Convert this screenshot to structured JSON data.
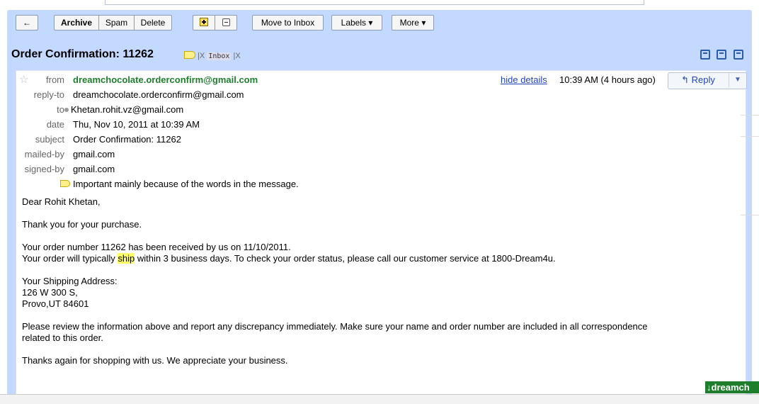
{
  "toolbar": {
    "back_label": "←",
    "archive_label": "Archive",
    "spam_label": "Spam",
    "delete_label": "Delete",
    "move_label": "Move to Inbox",
    "labels_label": "Labels ▾",
    "more_label": "More ▾"
  },
  "subject_bar": {
    "subject": "Order Confirmation: 11262",
    "x1": "|X",
    "inbox_tag": "Inbox",
    "x2": "|X"
  },
  "message": {
    "headers": {
      "from_label": "from",
      "from_value": "dreamchocolate.orderconfirm@gmail.com",
      "replyto_label": "reply-to",
      "replyto_value": "dreamchocolate.orderconfirm@gmail.com",
      "to_label": "to",
      "to_value": "Khetan.rohit.vz@gmail.com",
      "date_label": "date",
      "date_value": "Thu, Nov 10, 2011 at 10:39 AM",
      "subject_label": "subject",
      "subject_value": "Order Confirmation: 11262",
      "mailedby_label": "mailed-by",
      "mailedby_value": "gmail.com",
      "signedby_label": "signed-by",
      "signedby_value": "gmail.com",
      "importance_text": "Important mainly because of the words in the message."
    },
    "hide_details": "hide details",
    "time": "10:39 AM (4 hours ago)",
    "reply_label": "Reply",
    "body": {
      "greeting": "Dear Rohit Khetan,",
      "thanks": "Thank you for your purchase.",
      "order_line1": "Your order number 11262  has been received by us on 11/10/2011.",
      "order_line2_pre": "Your order will typically ",
      "order_line2_hl": "ship",
      "order_line2_post": " within 3 business days. To check your order status, please call our customer service at 1800-Dream4u.",
      "addr_title": "Your Shipping Address:",
      "addr_line1": "126 W 300 S,",
      "addr_line2": "Provo,UT 84601",
      "review_line1": "Please review the information above and report any discrepancy immediately. Make sure your name and order number are included in all correspondence",
      "review_line2": "related to this order.",
      "closing": "Thanks again for shopping with us. We appreciate your business."
    }
  },
  "footer_badge": "↓dreamch",
  "colors": {
    "frame": "#c3d9ff",
    "sender": "#1e7e2c",
    "link": "#2244bb",
    "highlight": "#ffff66"
  }
}
